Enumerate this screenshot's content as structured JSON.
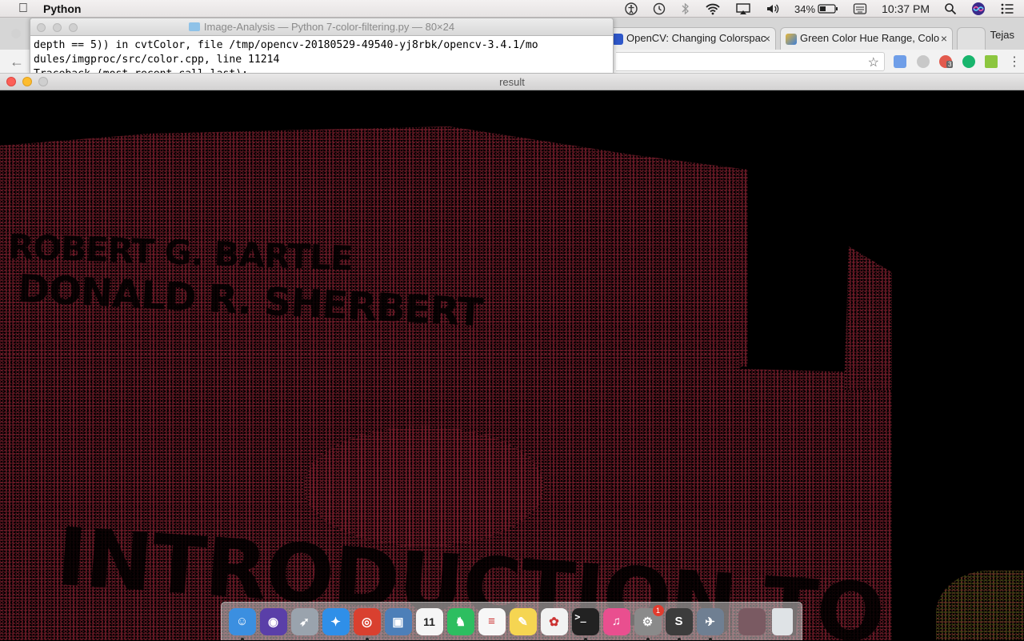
{
  "menubar": {
    "app_name": "Python",
    "battery": "34%",
    "time": "10:37 PM"
  },
  "browser": {
    "tabs": [
      {
        "title": "OpenCV: Changing Colorspac",
        "close": "×"
      },
      {
        "title": "Green Color Hue Range, Colo",
        "close": "×"
      }
    ],
    "user": "Tejas",
    "extension_badge": "3"
  },
  "terminal": {
    "title": "Image-Analysis — Python 7-color-filtering.py — 80×24",
    "lines": [
      "depth == 5)) in cvtColor, file /tmp/opencv-20180529-49540-yj8rbk/opencv-3.4.1/mo",
      "dules/imgproc/src/color.cpp, line 11214",
      "Traceback (most recent call last):"
    ]
  },
  "result_window": {
    "title": "result",
    "image_text": {
      "line1": "ROBERT G. BARTLE",
      "line2": "DONALD R. SHERBERT",
      "line3": "INTRODUCTION TO"
    }
  },
  "dock": {
    "items": [
      {
        "name": "Finder",
        "color": "#3b8fe0",
        "glyph": "☺",
        "running": true
      },
      {
        "name": "Siri",
        "color": "#5a3fa8",
        "glyph": "◉",
        "running": false
      },
      {
        "name": "Launchpad",
        "color": "#9aa3ad",
        "glyph": "➶",
        "running": false
      },
      {
        "name": "Safari",
        "color": "#2f8fe8",
        "glyph": "✦",
        "running": false
      },
      {
        "name": "Chrome",
        "color": "#d9402f",
        "glyph": "◎",
        "running": true
      },
      {
        "name": "Preview",
        "color": "#4d7fb8",
        "glyph": "▣",
        "running": false
      },
      {
        "name": "Calendar",
        "color": "#f5f5f5",
        "glyph": "11",
        "running": false
      },
      {
        "name": "Evernote",
        "color": "#2dbe60",
        "glyph": "♞",
        "running": false
      },
      {
        "name": "Reminders",
        "color": "#f7f7f7",
        "glyph": "≡",
        "running": false
      },
      {
        "name": "Notes",
        "color": "#f5d552",
        "glyph": "✎",
        "running": false
      },
      {
        "name": "Photos",
        "color": "#f2f2f2",
        "glyph": "✿",
        "running": false
      },
      {
        "name": "Terminal",
        "color": "#222222",
        "glyph": ">_",
        "running": true
      },
      {
        "name": "iTunes",
        "color": "#e94f8f",
        "glyph": "♫",
        "running": false
      },
      {
        "name": "System Preferences",
        "color": "#8a8a8a",
        "glyph": "⚙",
        "running": true,
        "badge": "1"
      },
      {
        "name": "Sublime Text",
        "color": "#3c3c3c",
        "glyph": "S",
        "running": true
      },
      {
        "name": "Python Launcher",
        "color": "#6f7f92",
        "glyph": "✈",
        "running": true
      }
    ],
    "stack": {
      "name": "Downloads",
      "color": "#7a5a62"
    },
    "trash": {
      "name": "Trash",
      "color": "#dfe3e6"
    }
  }
}
